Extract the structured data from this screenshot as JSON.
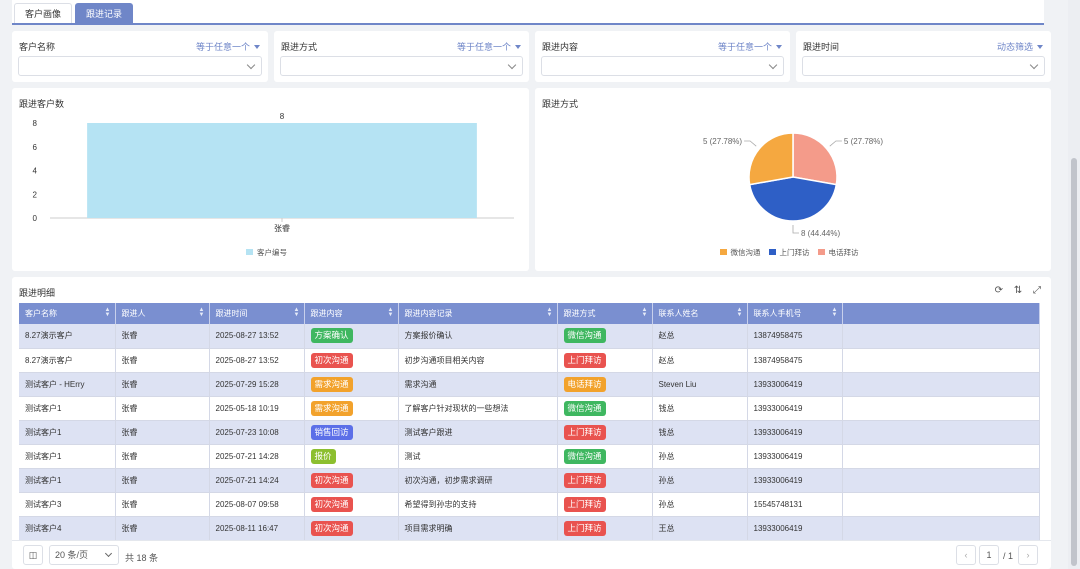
{
  "tabs": [
    {
      "label": "客户画像",
      "active": false
    },
    {
      "label": "跟进记录",
      "active": true
    }
  ],
  "filters": [
    {
      "label": "客户名称",
      "op": "等于任意一个"
    },
    {
      "label": "跟进方式",
      "op": "等于任意一个"
    },
    {
      "label": "跟进内容",
      "op": "等于任意一个"
    },
    {
      "label": "跟进时间",
      "op": "动态筛选"
    }
  ],
  "bar_panel": {
    "title": "跟进客户数"
  },
  "pie_panel": {
    "title": "跟进方式"
  },
  "chart_data": [
    {
      "type": "bar",
      "title": "跟进客户数",
      "categories": [
        "张睿"
      ],
      "series": [
        {
          "name": "客户编号",
          "values": [
            8
          ],
          "color": "#b5e3f3"
        }
      ],
      "ylim": [
        0,
        8
      ],
      "yticks": [
        0,
        2,
        4,
        6,
        8
      ],
      "data_labels": [
        "8"
      ],
      "grid": false,
      "legend": "bottom"
    },
    {
      "type": "pie",
      "title": "跟进方式",
      "slices": [
        {
          "name": "微信沟通",
          "value": 5,
          "label": "5 (27.78%)",
          "color": "#f5a840"
        },
        {
          "name": "上门拜访",
          "value": 8,
          "label": "8 (44.44%)",
          "color": "#2e5fc6"
        },
        {
          "name": "电话拜访",
          "value": 5,
          "label": "5 (27.78%)",
          "color": "#f49b8a"
        }
      ],
      "legend": "bottom"
    }
  ],
  "table": {
    "title": "跟进明细",
    "columns": [
      "客户名称",
      "跟进人",
      "跟进时间",
      "跟进内容",
      "跟进内容记录",
      "跟进方式",
      "联系人姓名",
      "联系人手机号"
    ],
    "rows": [
      [
        "8.27演示客户",
        "张睿",
        "2025-08-27 13:52",
        "方案确认",
        "方案报价确认",
        "微信沟通",
        "赵总",
        "13874958475"
      ],
      [
        "8.27演示客户",
        "张睿",
        "2025-08-27 13:52",
        "初次沟通",
        "初步沟通项目相关内容",
        "上门拜访",
        "赵总",
        "13874958475"
      ],
      [
        "测试客户 - HErry",
        "张睿",
        "2025-07-29 15:28",
        "需求沟通",
        "需求沟通",
        "电话拜访",
        "Steven Liu",
        "13933006419"
      ],
      [
        "测试客户1",
        "张睿",
        "2025-05-18 10:19",
        "需求沟通",
        "了解客户针对现状的一些想法",
        "微信沟通",
        "钱总",
        "13933006419"
      ],
      [
        "测试客户1",
        "张睿",
        "2025-07-23 10:08",
        "销售回访",
        "测试客户跟进",
        "上门拜访",
        "钱总",
        "13933006419"
      ],
      [
        "测试客户1",
        "张睿",
        "2025-07-21 14:28",
        "报价",
        "测试",
        "微信沟通",
        "孙总",
        "13933006419"
      ],
      [
        "测试客户1",
        "张睿",
        "2025-07-21 14:24",
        "初次沟通",
        "初次沟通，初步需求调研",
        "上门拜访",
        "孙总",
        "13933006419"
      ],
      [
        "测试客户3",
        "张睿",
        "2025-08-07 09:58",
        "初次沟通",
        "希望得到孙忠的支持",
        "上门拜访",
        "孙总",
        "15545748131"
      ],
      [
        "测试客户4",
        "张睿",
        "2025-08-11 16:47",
        "初次沟通",
        "项目需求明确",
        "上门拜访",
        "王总",
        "13933006419"
      ]
    ],
    "tag_colors": {
      "方案确认": "#3fb760",
      "初次沟通": "#e9534f",
      "需求沟通": "#f2a22c",
      "销售回访": "#5c6fe8",
      "报价": "#8cbf2f",
      "微信沟通": "#3fb760",
      "上门拜访": "#e9534f",
      "电话拜访": "#f2a22c"
    }
  },
  "pager": {
    "page_size": "20 条/页",
    "total": "共 18 条",
    "current_page": "1",
    "total_pages": "/ 1"
  },
  "icons": {
    "refresh": "refresh-icon",
    "column_settings": "column-settings-icon",
    "fullscreen": "fullscreen-icon",
    "collapse": "collapse-icon",
    "prev": "chevron-left-icon",
    "next": "chevron-right-icon",
    "select_caret": "chevron-down-icon"
  }
}
